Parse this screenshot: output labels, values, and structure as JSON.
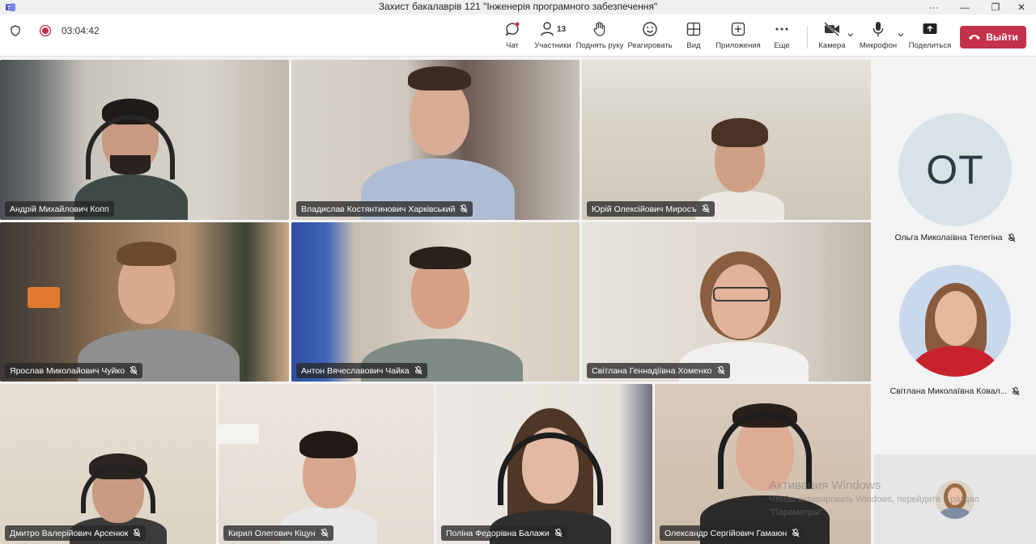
{
  "window": {
    "title": "Захист бакалаврів 121 \"Інженерія програмного забезпечення\"",
    "more": "···",
    "minimize": "—",
    "restore": "❐",
    "close": "✕"
  },
  "meeting": {
    "timer": "03:04:42",
    "participants_count": "13",
    "leave_label": "Выйти"
  },
  "toolbar": {
    "chat": "Чат",
    "participants": "Участники",
    "raise_hand": "Поднять руку",
    "react": "Реагировать",
    "view": "Вид",
    "apps": "Приложения",
    "more": "Еще",
    "camera": "Камера",
    "mic": "Микрофон",
    "share": "Поделиться"
  },
  "tiles": [
    {
      "name": "Андрій Михайлович Копп",
      "muted": false
    },
    {
      "name": "Владислав Костянтинович Харківський",
      "muted": true
    },
    {
      "name": "Юрій Олексійович Миросъ",
      "muted": true
    },
    {
      "name": "Ярослав Миколайович Чуйко",
      "muted": true
    },
    {
      "name": "Антон Вячеславович Чайка",
      "muted": true
    },
    {
      "name": "Світлана Геннадіївна Хоменко",
      "muted": true
    },
    {
      "name": "Дмитро Валерійович Арсенюк",
      "muted": true
    },
    {
      "name": "Кирил Олегович Кіцун",
      "muted": true
    },
    {
      "name": "Поліна Федорівна Балажи",
      "muted": true
    },
    {
      "name": "Олександр Сергійович Гамаюн",
      "muted": true
    }
  ],
  "side_participants": [
    {
      "initials": "ОТ",
      "name": "Ольга Миколаївна Телегіна",
      "muted": true
    },
    {
      "name": "Світлана Миколаївна Ковал...",
      "muted": true
    }
  ],
  "watermark": {
    "line1": "Активация Windows",
    "line2": "Чтобы активировать Windows, перейдите в раздел",
    "line3": "\"Параметры\"."
  },
  "colors": {
    "leave": "#c4314b",
    "name_tag_bg": "#282828",
    "avatar_bg": "#d8e3e8"
  }
}
